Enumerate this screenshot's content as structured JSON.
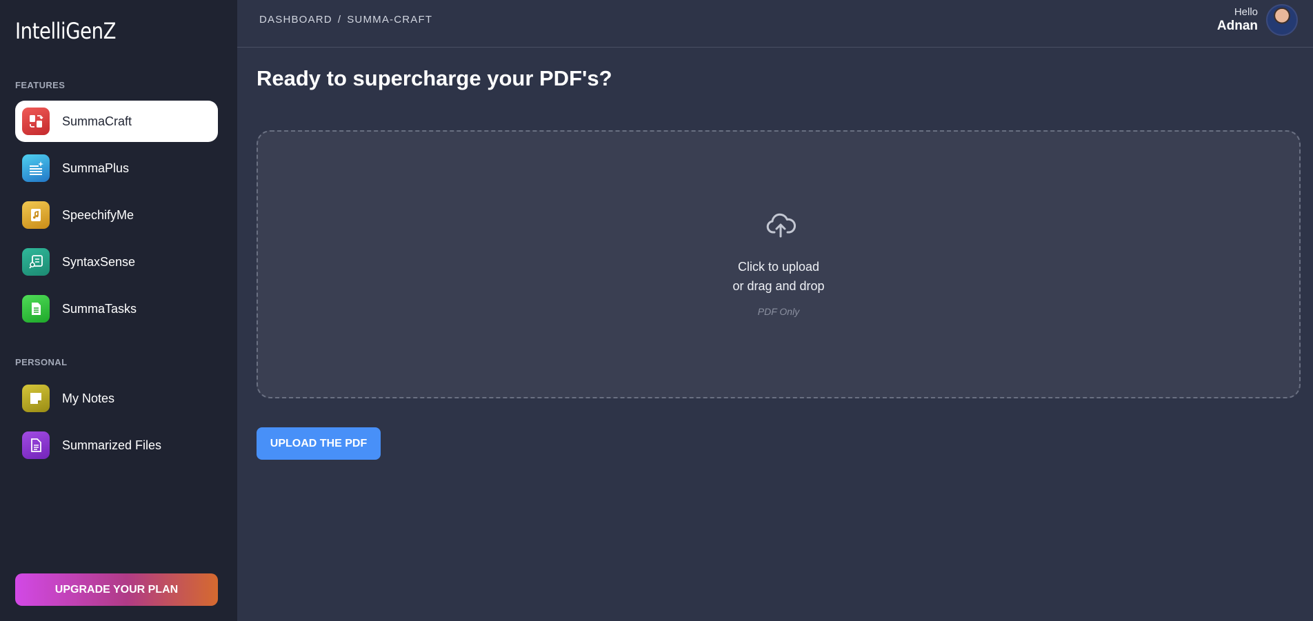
{
  "app": {
    "logo": "IntelliGenZ"
  },
  "sidebar": {
    "features_label": "FEATURES",
    "personal_label": "PERSONAL",
    "features": [
      {
        "label": "SummaCraft",
        "icon": "summacraft-icon",
        "active": true
      },
      {
        "label": "SummaPlus",
        "icon": "summaplus-icon"
      },
      {
        "label": "SpeechifyMe",
        "icon": "speechifyme-icon"
      },
      {
        "label": "SyntaxSense",
        "icon": "syntaxsense-icon"
      },
      {
        "label": "SummaTasks",
        "icon": "summatasks-icon"
      }
    ],
    "personal": [
      {
        "label": "My Notes",
        "icon": "notes-icon"
      },
      {
        "label": "Summarized Files",
        "icon": "file-icon"
      }
    ],
    "upgrade_label": "UPGRADE YOUR PLAN"
  },
  "header": {
    "breadcrumb": {
      "root": "DASHBOARD",
      "separator": "/",
      "current": "SUMMA-CRAFT"
    },
    "greeting": "Hello",
    "user_name": "Adnan"
  },
  "main": {
    "title": "Ready to supercharge your PDF's?",
    "dropzone": {
      "line1": "Click to upload",
      "line2": "or drag and drop",
      "hint": "PDF Only"
    },
    "upload_button": "UPLOAD THE PDF"
  },
  "colors": {
    "sidebar_bg": "#1f2331",
    "main_bg": "#2e3448",
    "dropzone_bg": "#3a3f52",
    "accent": "#4890f8"
  }
}
